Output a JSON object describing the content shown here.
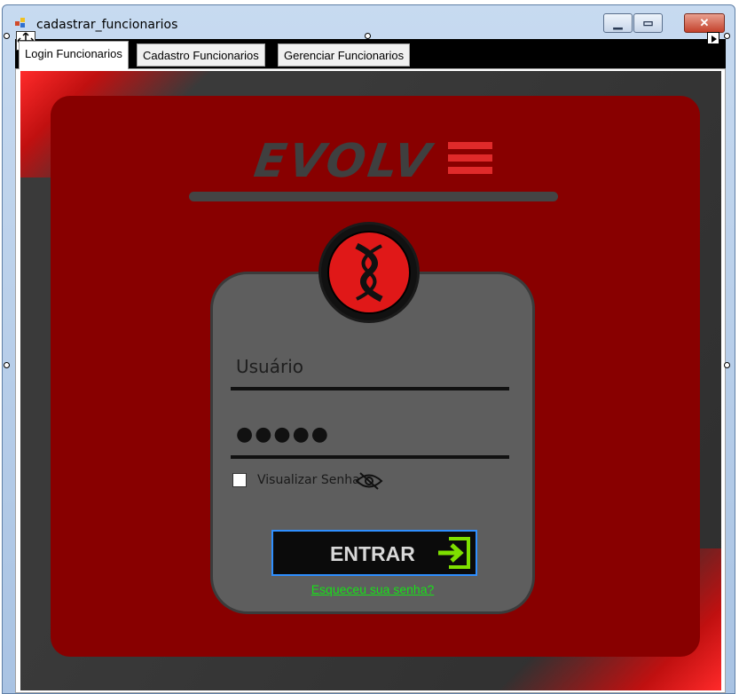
{
  "window": {
    "title": "cadastrar_funcionarios"
  },
  "tabs": [
    {
      "label": "Login Funcionarios",
      "active": true
    },
    {
      "label": "Cadastro Funcionarios",
      "active": false
    },
    {
      "label": "Gerenciar Funcionarios",
      "active": false
    }
  ],
  "login": {
    "brand": "EVOLV",
    "username_label": "Usuário",
    "password_mask": "●●●●●",
    "show_password_label": "Visualizar Senha",
    "show_password_checked": false,
    "enter_button": "ENTRAR",
    "forgot_link": "Esqueceu sua senha?"
  },
  "colors": {
    "panel_red": "#880000",
    "accent_red": "#e01818",
    "card_gray": "#5e5e5e",
    "link_green": "#19e019",
    "enter_icon_green": "#7ee000",
    "button_border_blue": "#2f8fff"
  },
  "icons": {
    "eye": "eye-slash-icon",
    "enter": "sign-in-icon",
    "emblem": "dna-emblem-icon"
  }
}
